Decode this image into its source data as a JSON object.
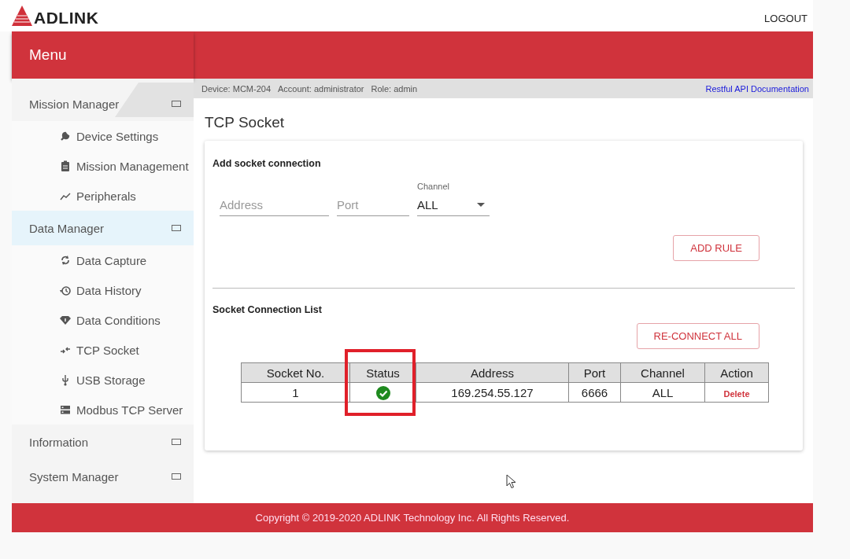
{
  "header": {
    "logo": "ADLINK",
    "logout": "LOGOUT"
  },
  "sidebar": {
    "title": "Menu",
    "groups": [
      {
        "label": "Mission Manager",
        "selected": false,
        "hovered": true,
        "children": [
          {
            "label": "Device Settings"
          },
          {
            "label": "Mission Management"
          },
          {
            "label": "Peripherals"
          }
        ]
      },
      {
        "label": "Data Manager",
        "selected": true,
        "hovered": false,
        "children": [
          {
            "label": "Data Capture"
          },
          {
            "label": "Data History"
          },
          {
            "label": "Data Conditions"
          },
          {
            "label": "TCP Socket"
          },
          {
            "label": "USB Storage"
          },
          {
            "label": "Modbus TCP Server"
          }
        ]
      },
      {
        "label": "Information",
        "selected": false,
        "hovered": false
      },
      {
        "label": "System Manager",
        "selected": false,
        "hovered": false
      }
    ]
  },
  "info_bar": {
    "items": [
      "Device: MCM-204",
      "Account: administrator",
      "Role: admin"
    ],
    "link": "Restful API Documentation"
  },
  "page_title": "TCP Socket",
  "add_section": {
    "title": "Add socket connection",
    "address": {
      "placeholder": "Address"
    },
    "port": {
      "placeholder": "Port"
    },
    "channel": {
      "label": "Channel",
      "value": "ALL"
    },
    "button": "ADD RULE"
  },
  "list_section": {
    "title": "Socket Connection List",
    "button": "RE-CONNECT ALL",
    "table": {
      "columns": [
        {
          "label": "Socket No.",
          "highlighted": false
        },
        {
          "label": "Status",
          "highlighted": true
        },
        {
          "label": "Address",
          "highlighted": false
        },
        {
          "label": "Port",
          "highlighted": false
        },
        {
          "label": "Channel",
          "highlighted": false
        },
        {
          "label": "Action",
          "highlighted": false
        }
      ],
      "rows": [
        {
          "socket_no": "1",
          "connected": true,
          "address": "169.254.55.127",
          "port": "6666",
          "channel": "ALL",
          "action": "Delete"
        }
      ]
    }
  },
  "footer": "Copyright © 2019-2020 ADLINK Technology Inc. All Rights Reserved."
}
